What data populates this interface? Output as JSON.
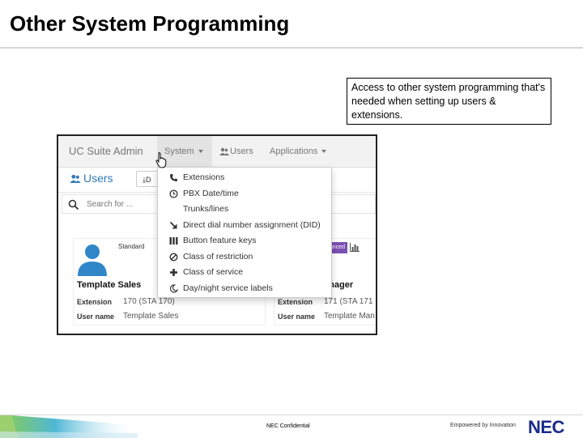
{
  "slide": {
    "title": "Other System Programming",
    "callout": "Access to other system programming that's needed when setting up users & extensions."
  },
  "app": {
    "brand": "UC Suite Admin",
    "nav": [
      {
        "label": "System",
        "icon": null,
        "active": true
      },
      {
        "label": "Users",
        "icon": "users-icon",
        "active": false
      },
      {
        "label": "Applications",
        "icon": null,
        "active": false
      }
    ],
    "page_heading": "Users",
    "download_button": "D",
    "search_placeholder": "Search for ...",
    "system_menu": [
      {
        "label": "Extensions",
        "icon": "phone-icon"
      },
      {
        "label": "PBX Date/time",
        "icon": "clock-icon"
      },
      {
        "label": "Trunks/lines",
        "icon": null
      },
      {
        "label": "Direct dial number assignment (DID)",
        "icon": "arrow-down-right-icon"
      },
      {
        "label": "Button feature keys",
        "icon": "bars-icon"
      },
      {
        "label": "Class of restriction",
        "icon": "ban-icon"
      },
      {
        "label": "Class of service",
        "icon": "plus-icon"
      },
      {
        "label": "Day/night service labels",
        "icon": "moon-icon"
      }
    ],
    "cards": [
      {
        "badge": "Standard",
        "name": "Template Sales",
        "extension_label": "Extension",
        "extension_value": "170 (STA 170)",
        "username_label": "User name",
        "username_value": "Template Sales"
      },
      {
        "badge": "...anced",
        "name": "...nager",
        "extension_label": "Extension",
        "extension_value": "171 (STA 171",
        "username_label": "User name",
        "username_value": "Template Man"
      }
    ]
  },
  "footer": {
    "confidential": "NEC Confidential",
    "tagline": "Empowered by Innovation",
    "logo": "NEC"
  },
  "colors": {
    "accent_blue": "#337ab7",
    "badge_purple": "#7a4fb0",
    "nec_blue": "#1a2c8c"
  }
}
